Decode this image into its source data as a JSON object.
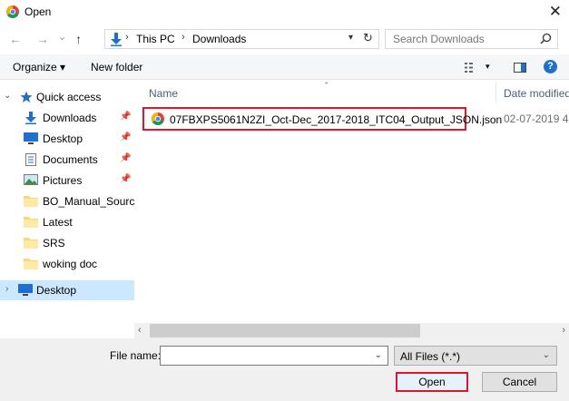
{
  "window": {
    "title": "Open",
    "close_glyph": "✕"
  },
  "nav": {
    "back": "←",
    "forward": "→",
    "recent": "⌄",
    "up": "↑",
    "breadcrumb": [
      "This PC",
      "Downloads"
    ],
    "sep": "›",
    "search_placeholder": "Search Downloads"
  },
  "toolbar": {
    "organize": "Organize ▾",
    "new_folder": "New folder",
    "help": "?"
  },
  "sidebar": {
    "items": [
      {
        "label": "Quick access"
      },
      {
        "label": "Downloads"
      },
      {
        "label": "Desktop"
      },
      {
        "label": "Documents"
      },
      {
        "label": "Pictures"
      },
      {
        "label": "BO_Manual_Source"
      },
      {
        "label": "Latest"
      },
      {
        "label": "SRS"
      },
      {
        "label": "woking doc"
      },
      {
        "label": "Desktop"
      }
    ]
  },
  "content": {
    "columns": {
      "name": "Name",
      "date": "Date modified"
    },
    "files": [
      {
        "name": "07FBXPS5061N2ZI_Oct-Dec_2017-2018_ITC04_Output_JSON.json",
        "date": "02-07-2019 4:"
      }
    ]
  },
  "bottom": {
    "file_name_label": "File name:",
    "file_name_value": "",
    "filter": "All Files (*.*)",
    "open": "Open",
    "cancel": "Cancel"
  },
  "colors": {
    "accent": "#1f6fd1",
    "highlight": "#e0142a",
    "selection": "#cce8ff"
  }
}
